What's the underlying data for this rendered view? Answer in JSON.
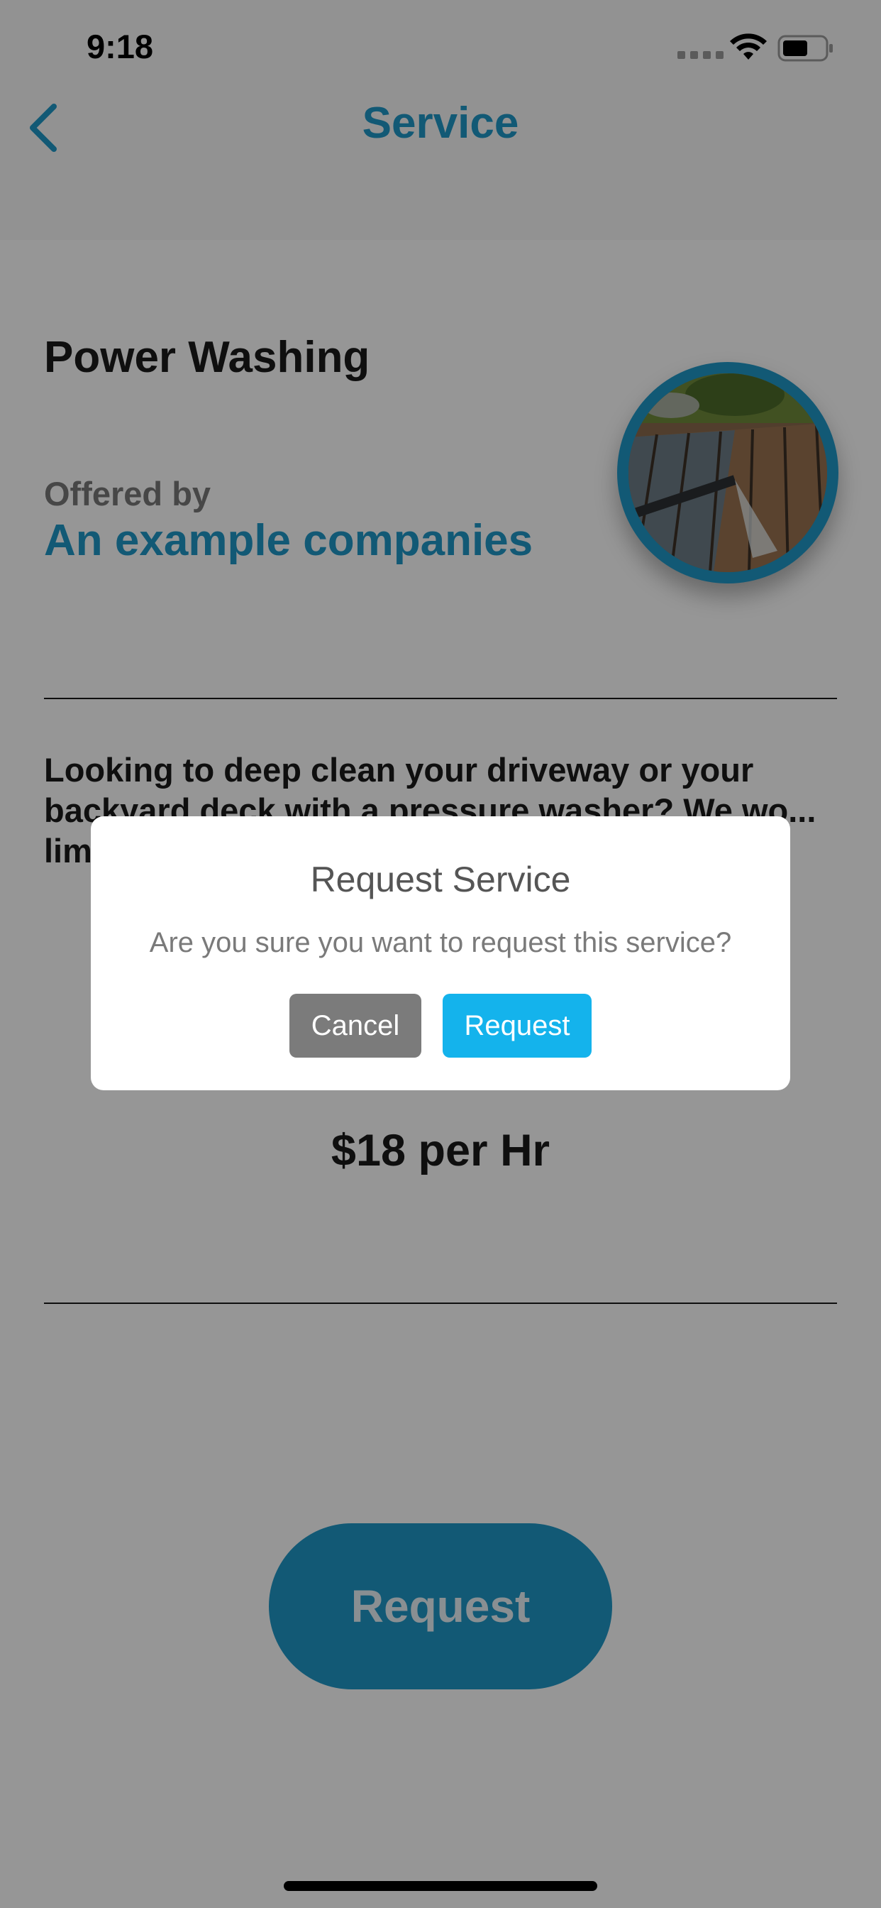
{
  "status_bar": {
    "time": "9:18",
    "icons": [
      "signal-icon",
      "wifi-icon",
      "battery-icon"
    ]
  },
  "nav": {
    "title": "Service",
    "back_icon": "chevron-left-icon"
  },
  "service": {
    "name": "Power Washing",
    "offered_by_label": "Offered by",
    "company": "An example companies",
    "description": "Looking to deep clean your driveway or your backyard deck with a pressure washer? We wo... lim... so po...",
    "price": "$18 per Hr",
    "request_label": "Request"
  },
  "dialog": {
    "title": "Request Service",
    "message": "Are you sure you want to request this service?",
    "cancel_label": "Cancel",
    "request_label": "Request"
  },
  "colors": {
    "accent": "#1f98c8",
    "dialog_request": "#14b3ec",
    "dialog_cancel": "#7b7b7b",
    "overlay": "rgba(0,0,0,0.41)"
  }
}
